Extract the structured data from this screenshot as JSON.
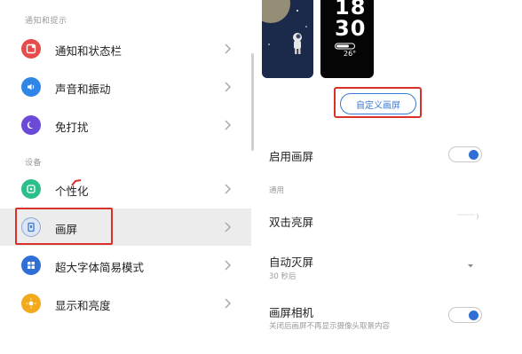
{
  "left": {
    "section_notifications": "通知和提示",
    "section_settings": "设备",
    "items": [
      {
        "label": "通知和状态栏",
        "icon": "notification-icon",
        "color": "#e74c4c"
      },
      {
        "label": "声音和振动",
        "icon": "speaker-icon",
        "color": "#2f86e6"
      },
      {
        "label": "免打扰",
        "icon": "moon-icon",
        "color": "#6a4ad6"
      },
      {
        "label": "个性化",
        "icon": "palette-icon",
        "color": "#2bbf8a"
      },
      {
        "label": "画屏",
        "icon": "frame-icon",
        "color": "#3a78d6"
      },
      {
        "label": "超大字体简易模式",
        "icon": "grid-icon",
        "color": "#2f6fd6"
      },
      {
        "label": "显示和亮度",
        "icon": "sun-icon",
        "color": "#f2a91b"
      }
    ]
  },
  "right": {
    "preview_time_hour": "18",
    "preview_time_min": "30",
    "preview_temp": "26°",
    "custom_button": "自定义画屏",
    "enable_label": "启用画屏",
    "section_general": "通用",
    "double_tap_label": "双击亮屏",
    "auto_off_label": "自动灭屏",
    "auto_off_value": "30 秒后",
    "camera_label": "画屏相机",
    "camera_desc": "关闭后画屏不再显示摄像头取景内容"
  },
  "colors": {
    "accent": "#2f6fd6",
    "highlight": "#d9302a"
  }
}
